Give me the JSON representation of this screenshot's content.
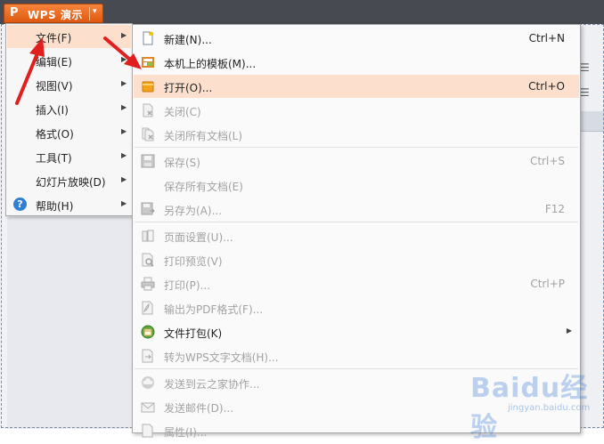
{
  "app": {
    "logo": "P",
    "title": "WPS 演示",
    "dropdown_glyph": "▾"
  },
  "main_menu": {
    "items": [
      {
        "label": "文件(F)",
        "highlighted": true,
        "has_submenu": true
      },
      {
        "label": "编辑(E)",
        "has_submenu": true
      },
      {
        "label": "视图(V)",
        "has_submenu": true
      },
      {
        "label": "插入(I)",
        "has_submenu": true
      },
      {
        "label": "格式(O)",
        "has_submenu": true
      },
      {
        "label": "工具(T)",
        "has_submenu": true
      },
      {
        "label": "幻灯片放映(D)",
        "has_submenu": true
      },
      {
        "label": "帮助(H)",
        "icon": "help-icon",
        "icon_glyph": "?",
        "has_submenu": true
      }
    ]
  },
  "file_menu": {
    "items": [
      {
        "label": "新建(N)...",
        "shortcut": "Ctrl+N",
        "icon": "new-file-icon",
        "enabled": true
      },
      {
        "label": "本机上的模板(M)...",
        "shortcut": "",
        "icon": "template-icon",
        "enabled": true
      },
      {
        "label": "打开(O)...",
        "shortcut": "Ctrl+O",
        "icon": "open-folder-icon",
        "enabled": true,
        "highlighted": true
      },
      {
        "label": "关闭(C)",
        "shortcut": "",
        "icon": "close-doc-icon",
        "enabled": false
      },
      {
        "label": "关闭所有文档(L)",
        "shortcut": "",
        "icon": "close-all-icon",
        "enabled": false
      },
      {
        "label": "保存(S)",
        "shortcut": "Ctrl+S",
        "icon": "save-icon",
        "enabled": false
      },
      {
        "label": "保存所有文档(E)",
        "shortcut": "",
        "icon": "",
        "enabled": false
      },
      {
        "label": "另存为(A)...",
        "shortcut": "F12",
        "icon": "save-as-icon",
        "enabled": false
      },
      {
        "label": "页面设置(U)...",
        "shortcut": "",
        "icon": "page-setup-icon",
        "enabled": false
      },
      {
        "label": "打印预览(V)",
        "shortcut": "",
        "icon": "print-preview-icon",
        "enabled": false
      },
      {
        "label": "打印(P)...",
        "shortcut": "Ctrl+P",
        "icon": "print-icon",
        "enabled": false
      },
      {
        "label": "输出为PDF格式(F)...",
        "shortcut": "",
        "icon": "pdf-icon",
        "enabled": false
      },
      {
        "label": "文件打包(K)",
        "shortcut": "",
        "icon": "package-icon",
        "enabled": true,
        "has_submenu": true
      },
      {
        "label": "转为WPS文字文档(H)...",
        "shortcut": "",
        "icon": "convert-icon",
        "enabled": false
      },
      {
        "label": "发送到云之家协作...",
        "shortcut": "",
        "icon": "cloud-icon",
        "enabled": false
      },
      {
        "label": "发送邮件(D)...",
        "shortcut": "",
        "icon": "mail-icon",
        "enabled": false
      },
      {
        "label": "属性(I)...",
        "shortcut": "",
        "icon": "properties-icon",
        "enabled": false
      }
    ]
  },
  "background": {
    "toolbar_glyphs": [
      "☰",
      "☰"
    ]
  },
  "watermark": {
    "brand": "Baidu经验",
    "url": "jingyan.baidu.com"
  },
  "colors": {
    "titlebar": "#474a50",
    "wps_orange": "#ea6a1f",
    "highlight": "#fce0cd",
    "arrow": "#e0201e",
    "disabled_text": "#a2a2a2"
  }
}
